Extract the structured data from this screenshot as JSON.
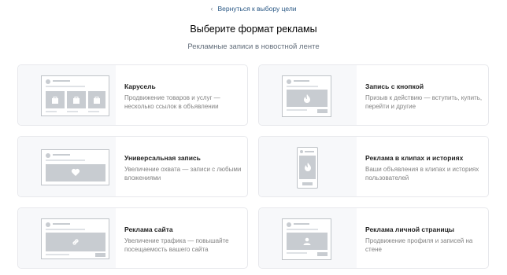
{
  "header": {
    "back_link": "Вернуться к выбору цели",
    "title": "Выберите формат рекламы",
    "subtitle": "Рекламные записи в новостной ленте"
  },
  "cards": [
    {
      "title": "Карусель",
      "description": "Продвижение товаров и услуг — несколько ссылок в объявлении",
      "icon": "carousel-preview-icon"
    },
    {
      "title": "Запись с кнопкой",
      "description": "Призыв к действию — вступить, купить, перейти и другие",
      "icon": "fire-button-preview-icon"
    },
    {
      "title": "Универсальная запись",
      "description": "Увеличение охвата — записи с любыми вложениями",
      "icon": "heart-preview-icon"
    },
    {
      "title": "Реклама в клипах и историях",
      "description": "Ваши объявления в клипах и историях пользователей",
      "icon": "phone-stories-preview-icon"
    },
    {
      "title": "Реклама сайта",
      "description": "Увеличение трафика — повышайте посещаемость вашего сайта",
      "icon": "link-preview-icon"
    },
    {
      "title": "Реклама личной страницы",
      "description": "Продвижение профиля и записей на стене",
      "icon": "user-preview-icon"
    }
  ]
}
